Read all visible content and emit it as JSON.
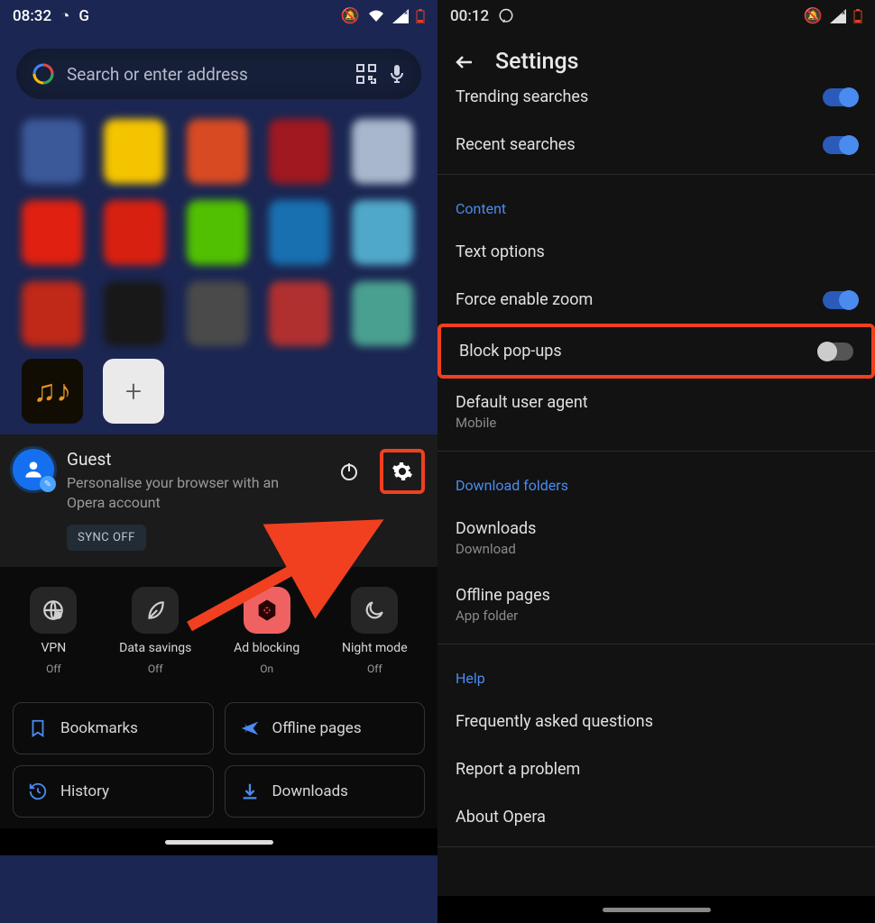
{
  "left": {
    "status": {
      "time": "08:32",
      "icons_left": [
        "firefox",
        "chrome"
      ],
      "icons_right": [
        "dnd",
        "wifi",
        "signal-x",
        "battery-low"
      ]
    },
    "search": {
      "placeholder": "Search or enter address"
    },
    "speeddial": {
      "tiles": [
        "#3b5998",
        "#f4c400",
        "#d84a22",
        "#a01820",
        "#a8b7cc",
        "#e02010",
        "#d82010",
        "#50c000",
        "#1870b0",
        "#50a8c8",
        "#c02818",
        "#181818",
        "#4a4a4a",
        "#b03030",
        "#4aa090"
      ],
      "music_tile": "♫♪",
      "add_tile": "+"
    },
    "profile": {
      "name": "Guest",
      "sub": "Personalise your browser with an Opera account",
      "sync": "SYNC OFF"
    },
    "quick": [
      {
        "label": "VPN",
        "sub": "Off",
        "icon": "globe"
      },
      {
        "label": "Data savings",
        "sub": "Off",
        "icon": "leaf"
      },
      {
        "label": "Ad blocking",
        "sub": "On",
        "icon": "hex",
        "active": true
      },
      {
        "label": "Night mode",
        "sub": "Off",
        "icon": "moon"
      }
    ],
    "big": [
      {
        "label": "Bookmarks",
        "icon": "bookmark"
      },
      {
        "label": "Offline pages",
        "icon": "plane"
      },
      {
        "label": "History",
        "icon": "history"
      },
      {
        "label": "Downloads",
        "icon": "download"
      }
    ]
  },
  "right": {
    "status": {
      "time": "00:12",
      "icons_left": [
        "whatsapp"
      ],
      "icons_right": [
        "dnd",
        "signal-x",
        "battery-low"
      ]
    },
    "title": "Settings",
    "rows_top": [
      {
        "label": "Trending searches",
        "toggle": "on"
      },
      {
        "label": "Recent searches",
        "toggle": "on"
      }
    ],
    "sections": [
      {
        "heading": "Content",
        "rows": [
          {
            "label": "Text options"
          },
          {
            "label": "Force enable zoom",
            "toggle": "on"
          },
          {
            "label": "Block pop-ups",
            "toggle": "off",
            "hl": true
          },
          {
            "label": "Default user agent",
            "sub": "Mobile"
          }
        ]
      },
      {
        "heading": "Download folders",
        "rows": [
          {
            "label": "Downloads",
            "sub": "Download"
          },
          {
            "label": "Offline pages",
            "sub": "App folder"
          }
        ]
      },
      {
        "heading": "Help",
        "rows": [
          {
            "label": "Frequently asked questions"
          },
          {
            "label": "Report a problem"
          },
          {
            "label": "About Opera"
          }
        ]
      }
    ]
  }
}
